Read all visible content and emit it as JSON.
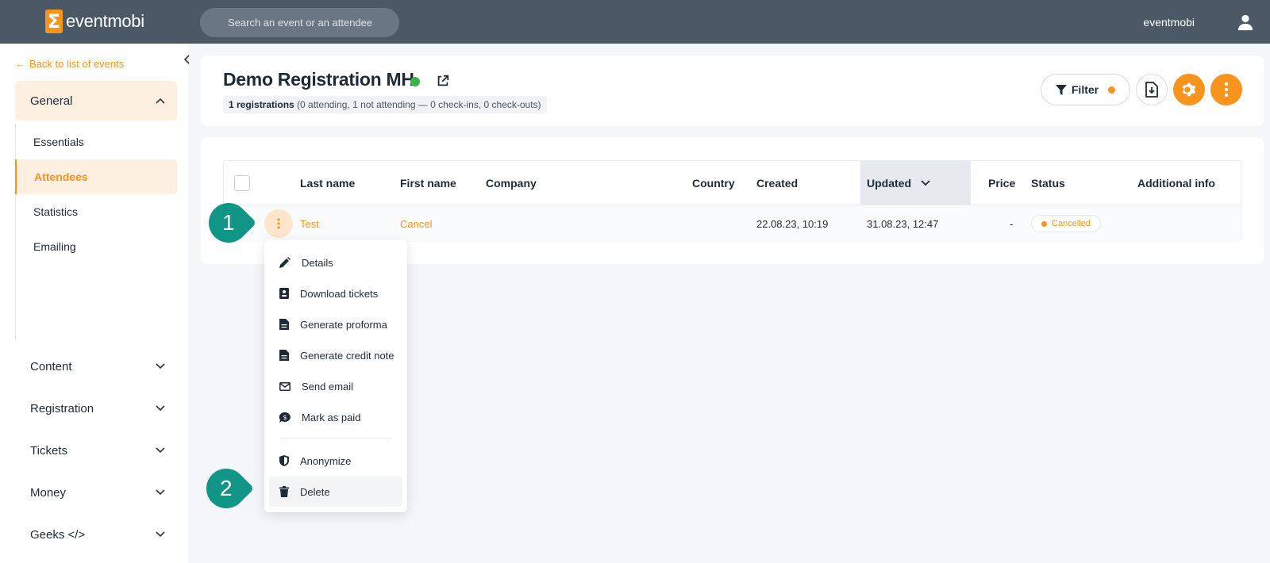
{
  "topbar": {
    "logo_text": "eventmobi",
    "search_placeholder": "Search an event or an attendee",
    "username": "eventmobi"
  },
  "sidebar": {
    "back_label": "Back to list of events",
    "general_label": "General",
    "sub_items": [
      {
        "label": "Essentials"
      },
      {
        "label": "Attendees"
      },
      {
        "label": "Statistics"
      },
      {
        "label": "Emailing"
      }
    ],
    "sections": [
      {
        "label": "Content"
      },
      {
        "label": "Registration"
      },
      {
        "label": "Tickets"
      },
      {
        "label": "Money"
      },
      {
        "label": "Geeks </>"
      }
    ]
  },
  "header": {
    "title": "Demo Registration MH",
    "summary_bold": "1 registrations",
    "summary_rest": "(0 attending, 1 not attending — 0 check-ins, 0 check-outs)",
    "filter_label": "Filter"
  },
  "table": {
    "columns": [
      "Last name",
      "First name",
      "Company",
      "Country",
      "Created",
      "Updated",
      "Price",
      "Status",
      "Additional info"
    ],
    "rows": [
      {
        "last_name": "Test",
        "first_name": "Cancel",
        "company": "",
        "country": "",
        "created": "22.08.23, 10:19",
        "updated": "31.08.23, 12:47",
        "price": "-",
        "status": "Cancelled",
        "additional_info": ""
      }
    ]
  },
  "row_menu": {
    "items": [
      {
        "label": "Details",
        "icon": "pencil-icon"
      },
      {
        "label": "Download tickets",
        "icon": "ticket-icon"
      },
      {
        "label": "Generate proforma",
        "icon": "document-icon"
      },
      {
        "label": "Generate credit note",
        "icon": "document-icon"
      },
      {
        "label": "Send email",
        "icon": "envelope-icon"
      },
      {
        "label": "Mark as paid",
        "icon": "money-icon"
      },
      {
        "label": "Anonymize",
        "icon": "shield-icon"
      },
      {
        "label": "Delete",
        "icon": "trash-icon"
      }
    ]
  },
  "callouts": [
    "1",
    "2"
  ],
  "colors": {
    "brand_orange": "#f7941d",
    "topbar": "#4b5866",
    "callout_teal": "#109587",
    "status_green": "#3cb34a"
  }
}
